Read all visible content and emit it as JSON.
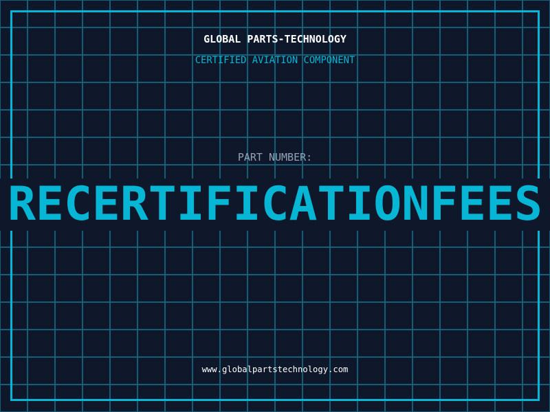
{
  "header": {
    "title": "GLOBAL PARTS-TECHNOLOGY",
    "subtitle": "CERTIFIED AVIATION COMPONENT"
  },
  "part": {
    "label": "PART NUMBER:",
    "number": "RECERTIFICATIONFEES"
  },
  "footer": {
    "url": "www.globalpartstechnology.com"
  },
  "colors": {
    "background": "#0f172a",
    "accent": "#06b6d4",
    "grid": "#155e75",
    "label": "#94a3b8"
  }
}
